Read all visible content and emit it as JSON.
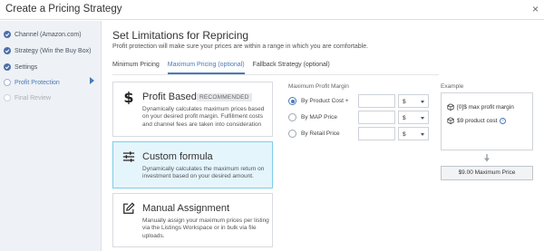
{
  "window": {
    "title": "Create a Pricing Strategy",
    "close_glyph": "×"
  },
  "sidebar": {
    "steps": [
      {
        "label": "Channel (Amazon.com)",
        "state": "done"
      },
      {
        "label": "Strategy (Win the Buy Box)",
        "state": "done"
      },
      {
        "label": "Settings",
        "state": "done"
      },
      {
        "label": "Profit Protection",
        "state": "current"
      },
      {
        "label": "Final Review",
        "state": "pending"
      }
    ]
  },
  "main": {
    "heading": "Set Limitations for Repricing",
    "subtitle": "Profit protection will make sure your prices are within a range in which you are comfortable.",
    "tabs": [
      {
        "label": "Minimum Pricing",
        "active": false
      },
      {
        "label": "Maximum Pricing (optional)",
        "active": true
      },
      {
        "label": "Fallback Strategy (optional)",
        "active": false
      }
    ],
    "options": [
      {
        "icon": "dollar-icon",
        "title": "Profit Based",
        "badge": "RECOMMENDED",
        "description": "Dynamically calculates maximum prices based on your desired profit margin. Fulfillment costs and channel fees are taken into consideration",
        "selected": false
      },
      {
        "icon": "sliders-icon",
        "title": "Custom formula",
        "description": "Dynamically calculates the maximum return on investment based on your desired amount.",
        "selected": true
      },
      {
        "icon": "edit-icon",
        "title": "Manual Assignment",
        "description": "Manually assign your maximum prices per listing via the Listings Workspace or in bulk via file uploads.",
        "selected": false
      }
    ],
    "margin": {
      "label": "Maximum Profit Margin",
      "rows": [
        {
          "label": "By Product Cost +",
          "checked": true,
          "value": "",
          "unit": "$"
        },
        {
          "label": "By MAP Price",
          "checked": false,
          "value": "",
          "unit": "$"
        },
        {
          "label": "By Retail Price",
          "checked": false,
          "value": "",
          "unit": "$"
        }
      ]
    },
    "example": {
      "label": "Example",
      "line1": "[0]$ max profit margin",
      "line2": "$9 product cost",
      "info_glyph": "i",
      "result": "$9.00 Maximum Price"
    }
  },
  "colors": {
    "accent": "#4a7ab8",
    "selected_card_bg": "#e5f5fc",
    "sidebar_bg": "#eef1f5"
  }
}
